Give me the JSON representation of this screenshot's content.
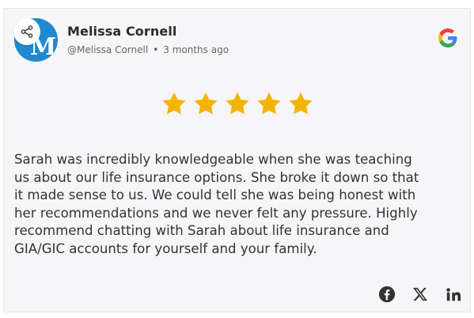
{
  "review": {
    "author_name": "Melissa Cornell",
    "author_handle": "@Melissa Cornell",
    "separator": "•",
    "time_ago": "3 months ago",
    "avatar_letter": "M",
    "rating": 5,
    "max_rating": 5,
    "text": "Sarah was incredibly knowledgeable when she was teaching\nus about our life insurance options. She broke it down so that\nit made sense to us. We could tell she was being honest with\nher recommendations and we never felt any pressure. Highly\nrecommend chatting with Sarah about life insurance and\nGIA/GIC accounts for yourself and your family.",
    "source_icon": "google-icon"
  },
  "share": {
    "icon": "share-icon"
  },
  "social_links": [
    {
      "name": "facebook-icon"
    },
    {
      "name": "x-icon"
    },
    {
      "name": "linkedin-icon"
    }
  ],
  "colors": {
    "card_background": "#f6f6f8",
    "avatar_background": "#1f8ad0",
    "star": "#f4b400",
    "text": "#333333",
    "icon": "#333333"
  }
}
